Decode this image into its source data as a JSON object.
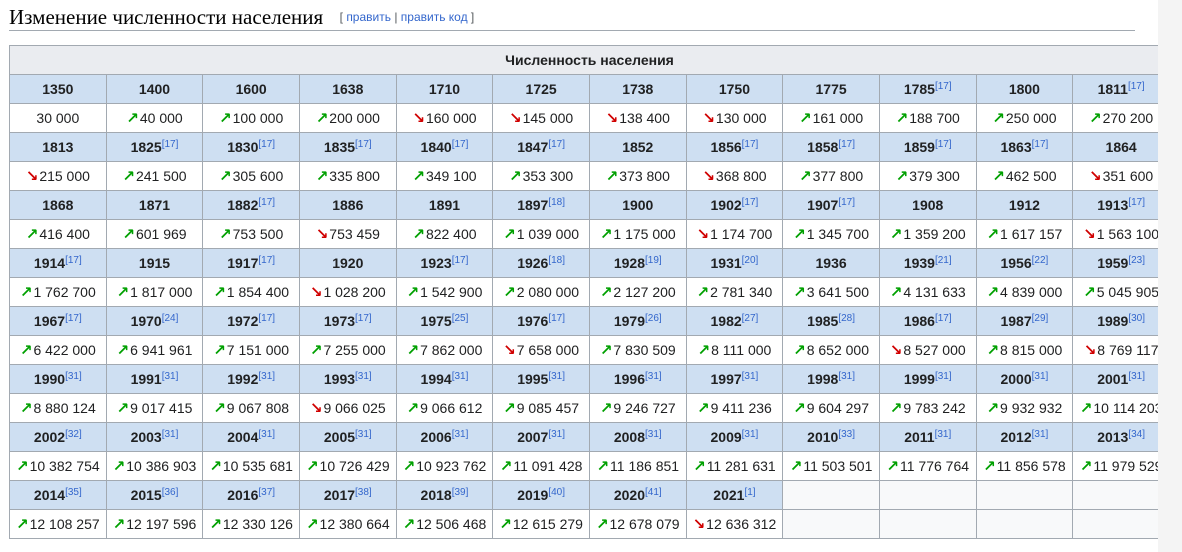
{
  "section": {
    "title": "Изменение численности населения",
    "edit_open": "[ ",
    "edit_label": "править",
    "edit_sep": " | ",
    "edit_code_label": "править код",
    "edit_close": " ]"
  },
  "table": {
    "caption": "Численность населения",
    "rows": [
      [
        {
          "year": "1350",
          "ref": "",
          "value": "30 000",
          "trend": ""
        },
        {
          "year": "1400",
          "ref": "",
          "value": "40 000",
          "trend": "up"
        },
        {
          "year": "1600",
          "ref": "",
          "value": "100 000",
          "trend": "up"
        },
        {
          "year": "1638",
          "ref": "",
          "value": "200 000",
          "trend": "up"
        },
        {
          "year": "1710",
          "ref": "",
          "value": "160 000",
          "trend": "down"
        },
        {
          "year": "1725",
          "ref": "",
          "value": "145 000",
          "trend": "down"
        },
        {
          "year": "1738",
          "ref": "",
          "value": "138 400",
          "trend": "down"
        },
        {
          "year": "1750",
          "ref": "",
          "value": "130 000",
          "trend": "down"
        },
        {
          "year": "1775",
          "ref": "",
          "value": "161 000",
          "trend": "up"
        },
        {
          "year": "1785",
          "ref": "[17]",
          "value": "188 700",
          "trend": "up"
        },
        {
          "year": "1800",
          "ref": "",
          "value": "250 000",
          "trend": "up"
        },
        {
          "year": "1811",
          "ref": "[17]",
          "value": "270 200",
          "trend": "up"
        }
      ],
      [
        {
          "year": "1813",
          "ref": "",
          "value": "215 000",
          "trend": "down"
        },
        {
          "year": "1825",
          "ref": "[17]",
          "value": "241 500",
          "trend": "up"
        },
        {
          "year": "1830",
          "ref": "[17]",
          "value": "305 600",
          "trend": "up"
        },
        {
          "year": "1835",
          "ref": "[17]",
          "value": "335 800",
          "trend": "up"
        },
        {
          "year": "1840",
          "ref": "[17]",
          "value": "349 100",
          "trend": "up"
        },
        {
          "year": "1847",
          "ref": "[17]",
          "value": "353 300",
          "trend": "up"
        },
        {
          "year": "1852",
          "ref": "",
          "value": "373 800",
          "trend": "up"
        },
        {
          "year": "1856",
          "ref": "[17]",
          "value": "368 800",
          "trend": "down"
        },
        {
          "year": "1858",
          "ref": "[17]",
          "value": "377 800",
          "trend": "up"
        },
        {
          "year": "1859",
          "ref": "[17]",
          "value": "379 300",
          "trend": "up"
        },
        {
          "year": "1863",
          "ref": "[17]",
          "value": "462 500",
          "trend": "up"
        },
        {
          "year": "1864",
          "ref": "",
          "value": "351 600",
          "trend": "down"
        }
      ],
      [
        {
          "year": "1868",
          "ref": "",
          "value": "416 400",
          "trend": "up"
        },
        {
          "year": "1871",
          "ref": "",
          "value": "601 969",
          "trend": "up"
        },
        {
          "year": "1882",
          "ref": "[17]",
          "value": "753 500",
          "trend": "up"
        },
        {
          "year": "1886",
          "ref": "",
          "value": "753 459",
          "trend": "down"
        },
        {
          "year": "1891",
          "ref": "",
          "value": "822 400",
          "trend": "up"
        },
        {
          "year": "1897",
          "ref": "[18]",
          "value": "1 039 000",
          "trend": "up"
        },
        {
          "year": "1900",
          "ref": "",
          "value": "1 175 000",
          "trend": "up"
        },
        {
          "year": "1902",
          "ref": "[17]",
          "value": "1 174 700",
          "trend": "down"
        },
        {
          "year": "1907",
          "ref": "[17]",
          "value": "1 345 700",
          "trend": "up"
        },
        {
          "year": "1908",
          "ref": "",
          "value": "1 359 200",
          "trend": "up"
        },
        {
          "year": "1912",
          "ref": "",
          "value": "1 617 157",
          "trend": "up"
        },
        {
          "year": "1913",
          "ref": "[17]",
          "value": "1 563 100",
          "trend": "down"
        }
      ],
      [
        {
          "year": "1914",
          "ref": "[17]",
          "value": "1 762 700",
          "trend": "up"
        },
        {
          "year": "1915",
          "ref": "",
          "value": "1 817 000",
          "trend": "up"
        },
        {
          "year": "1917",
          "ref": "[17]",
          "value": "1 854 400",
          "trend": "up"
        },
        {
          "year": "1920",
          "ref": "",
          "value": "1 028 200",
          "trend": "down"
        },
        {
          "year": "1923",
          "ref": "[17]",
          "value": "1 542 900",
          "trend": "up"
        },
        {
          "year": "1926",
          "ref": "[18]",
          "value": "2 080 000",
          "trend": "up"
        },
        {
          "year": "1928",
          "ref": "[19]",
          "value": "2 127 200",
          "trend": "up"
        },
        {
          "year": "1931",
          "ref": "[20]",
          "value": "2 781 340",
          "trend": "up"
        },
        {
          "year": "1936",
          "ref": "",
          "value": "3 641 500",
          "trend": "up"
        },
        {
          "year": "1939",
          "ref": "[21]",
          "value": "4 131 633",
          "trend": "up"
        },
        {
          "year": "1956",
          "ref": "[22]",
          "value": "4 839 000",
          "trend": "up"
        },
        {
          "year": "1959",
          "ref": "[23]",
          "value": "5 045 905",
          "trend": "up"
        }
      ],
      [
        {
          "year": "1967",
          "ref": "[17]",
          "value": "6 422 000",
          "trend": "up"
        },
        {
          "year": "1970",
          "ref": "[24]",
          "value": "6 941 961",
          "trend": "up"
        },
        {
          "year": "1972",
          "ref": "[17]",
          "value": "7 151 000",
          "trend": "up"
        },
        {
          "year": "1973",
          "ref": "[17]",
          "value": "7 255 000",
          "trend": "up"
        },
        {
          "year": "1975",
          "ref": "[25]",
          "value": "7 862 000",
          "trend": "up"
        },
        {
          "year": "1976",
          "ref": "[17]",
          "value": "7 658 000",
          "trend": "down"
        },
        {
          "year": "1979",
          "ref": "[26]",
          "value": "7 830 509",
          "trend": "up"
        },
        {
          "year": "1982",
          "ref": "[27]",
          "value": "8 111 000",
          "trend": "up"
        },
        {
          "year": "1985",
          "ref": "[28]",
          "value": "8 652 000",
          "trend": "up"
        },
        {
          "year": "1986",
          "ref": "[17]",
          "value": "8 527 000",
          "trend": "down"
        },
        {
          "year": "1987",
          "ref": "[29]",
          "value": "8 815 000",
          "trend": "up"
        },
        {
          "year": "1989",
          "ref": "[30]",
          "value": "8 769 117",
          "trend": "down"
        }
      ],
      [
        {
          "year": "1990",
          "ref": "[31]",
          "value": "8 880 124",
          "trend": "up"
        },
        {
          "year": "1991",
          "ref": "[31]",
          "value": "9 017 415",
          "trend": "up"
        },
        {
          "year": "1992",
          "ref": "[31]",
          "value": "9 067 808",
          "trend": "up"
        },
        {
          "year": "1993",
          "ref": "[31]",
          "value": "9 066 025",
          "trend": "down"
        },
        {
          "year": "1994",
          "ref": "[31]",
          "value": "9 066 612",
          "trend": "up"
        },
        {
          "year": "1995",
          "ref": "[31]",
          "value": "9 085 457",
          "trend": "up"
        },
        {
          "year": "1996",
          "ref": "[31]",
          "value": "9 246 727",
          "trend": "up"
        },
        {
          "year": "1997",
          "ref": "[31]",
          "value": "9 411 236",
          "trend": "up"
        },
        {
          "year": "1998",
          "ref": "[31]",
          "value": "9 604 297",
          "trend": "up"
        },
        {
          "year": "1999",
          "ref": "[31]",
          "value": "9 783 242",
          "trend": "up"
        },
        {
          "year": "2000",
          "ref": "[31]",
          "value": "9 932 932",
          "trend": "up"
        },
        {
          "year": "2001",
          "ref": "[31]",
          "value": "10 114 203",
          "trend": "up"
        }
      ],
      [
        {
          "year": "2002",
          "ref": "[32]",
          "value": "10 382 754",
          "trend": "up"
        },
        {
          "year": "2003",
          "ref": "[31]",
          "value": "10 386 903",
          "trend": "up"
        },
        {
          "year": "2004",
          "ref": "[31]",
          "value": "10 535 681",
          "trend": "up"
        },
        {
          "year": "2005",
          "ref": "[31]",
          "value": "10 726 429",
          "trend": "up"
        },
        {
          "year": "2006",
          "ref": "[31]",
          "value": "10 923 762",
          "trend": "up"
        },
        {
          "year": "2007",
          "ref": "[31]",
          "value": "11 091 428",
          "trend": "up"
        },
        {
          "year": "2008",
          "ref": "[31]",
          "value": "11 186 851",
          "trend": "up"
        },
        {
          "year": "2009",
          "ref": "[31]",
          "value": "11 281 631",
          "trend": "up"
        },
        {
          "year": "2010",
          "ref": "[33]",
          "value": "11 503 501",
          "trend": "up"
        },
        {
          "year": "2011",
          "ref": "[31]",
          "value": "11 776 764",
          "trend": "up"
        },
        {
          "year": "2012",
          "ref": "[31]",
          "value": "11 856 578",
          "trend": "up"
        },
        {
          "year": "2013",
          "ref": "[34]",
          "value": "11 979 529",
          "trend": "up"
        }
      ],
      [
        {
          "year": "2014",
          "ref": "[35]",
          "value": "12 108 257",
          "trend": "up"
        },
        {
          "year": "2015",
          "ref": "[36]",
          "value": "12 197 596",
          "trend": "up"
        },
        {
          "year": "2016",
          "ref": "[37]",
          "value": "12 330 126",
          "trend": "up"
        },
        {
          "year": "2017",
          "ref": "[38]",
          "value": "12 380 664",
          "trend": "up"
        },
        {
          "year": "2018",
          "ref": "[39]",
          "value": "12 506 468",
          "trend": "up"
        },
        {
          "year": "2019",
          "ref": "[40]",
          "value": "12 615 279",
          "trend": "up"
        },
        {
          "year": "2020",
          "ref": "[41]",
          "value": "12 678 079",
          "trend": "up"
        },
        {
          "year": "2021",
          "ref": "[1]",
          "value": "12 636 312",
          "trend": "down"
        },
        {
          "year": "",
          "ref": "",
          "value": "",
          "trend": ""
        },
        {
          "year": "",
          "ref": "",
          "value": "",
          "trend": ""
        },
        {
          "year": "",
          "ref": "",
          "value": "",
          "trend": ""
        },
        {
          "year": "",
          "ref": "",
          "value": "",
          "trend": ""
        }
      ]
    ]
  },
  "icons": {
    "up": "trend-up-arrow",
    "down": "trend-down-arrow"
  },
  "colors": {
    "header_bg": "#cedff2",
    "caption_bg": "#eaecf0",
    "border": "#a2a9b1",
    "link": "#3366cc",
    "up": "#00a000",
    "down": "#d00000"
  }
}
